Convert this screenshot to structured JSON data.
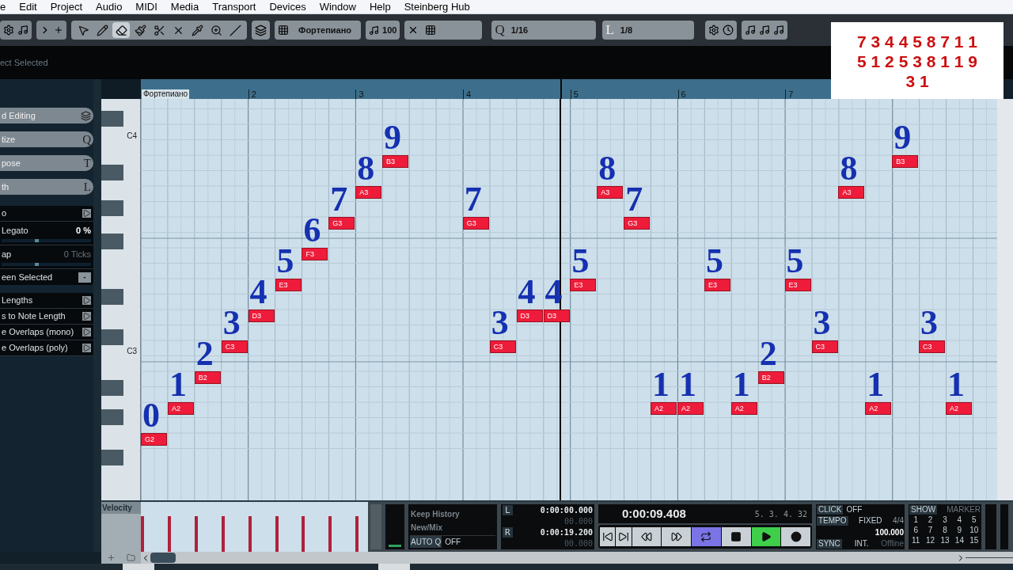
{
  "menu": [
    "e",
    "Edit",
    "Project",
    "Audio",
    "MIDI",
    "Media",
    "Transport",
    "Devices",
    "Window",
    "Help",
    "Steinberg Hub"
  ],
  "toolbar": {
    "tools": [
      {
        "kind": "arrow",
        "selected": false
      },
      {
        "kind": "pencil",
        "selected": false
      },
      {
        "kind": "eraser",
        "selected": true
      },
      {
        "kind": "brush",
        "selected": false
      },
      {
        "kind": "scissors",
        "selected": false
      },
      {
        "kind": "mute",
        "selected": false
      },
      {
        "kind": "glue",
        "selected": false
      },
      {
        "kind": "zoom",
        "selected": false
      },
      {
        "kind": "line",
        "selected": false
      }
    ],
    "instrument": "Фортепиано",
    "velocity": "100",
    "quantize_key": "Q",
    "quantize": "1/16",
    "length_key": "L",
    "length": "1/8"
  },
  "info_line": "ect Selected",
  "overlay_digits": [
    "7 3 4 4 5 8 7 1 1",
    "5 1 2 5 3 8 1 1 9",
    "3 1"
  ],
  "inspector": {
    "sections": [
      {
        "label": "d Editing"
      },
      {
        "label": "tize",
        "key": "Q"
      },
      {
        "label": "pose",
        "key": "T"
      },
      {
        "label": "th",
        "key": "L"
      }
    ],
    "functions": [
      {
        "kind": "run",
        "label": "o"
      },
      {
        "kind": "slider",
        "label": "Legato",
        "value": "0 %",
        "level": 0.37,
        "disabled": false
      },
      {
        "kind": "slider",
        "label": "ap",
        "value": "0 Ticks",
        "level": 0.37,
        "disabled": true
      },
      {
        "kind": "toggle",
        "label": "een Selected",
        "button": "-"
      }
    ],
    "actions": [
      {
        "label": "Lengths"
      },
      {
        "label": "s to Note Length"
      },
      {
        "label": "e Overlaps (mono)"
      },
      {
        "label": "e Overlaps (poly)"
      }
    ]
  },
  "keyboard_labels": [
    "C4",
    "C3"
  ],
  "ruler": {
    "track_label": "Фортепиано",
    "bars": [
      "2",
      "3",
      "4",
      "5",
      "6",
      "7"
    ]
  },
  "notes": [
    {
      "pitch": "G2",
      "number": "0"
    },
    {
      "pitch": "A2",
      "number": "1"
    },
    {
      "pitch": "B2",
      "number": "2"
    },
    {
      "pitch": "C3",
      "number": "3"
    },
    {
      "pitch": "D3",
      "number": "4"
    },
    {
      "pitch": "E3",
      "number": "5"
    },
    {
      "pitch": "F3",
      "number": "6"
    },
    {
      "pitch": "G3",
      "number": "7"
    },
    {
      "pitch": "A3",
      "number": "8"
    },
    {
      "pitch": "B3",
      "number": "9"
    },
    {
      "pitch": "G3",
      "number": "7"
    },
    {
      "pitch": "C3",
      "number": "3"
    },
    {
      "pitch": "D3",
      "number": "4"
    },
    {
      "pitch": "D3",
      "number": "4"
    },
    {
      "pitch": "E3",
      "number": "5"
    },
    {
      "pitch": "A3",
      "number": "8"
    },
    {
      "pitch": "G3",
      "number": "7"
    },
    {
      "pitch": "A2",
      "number": "1"
    },
    {
      "pitch": "A2",
      "number": "1"
    },
    {
      "pitch": "E3",
      "number": "5"
    },
    {
      "pitch": "A2",
      "number": "1"
    },
    {
      "pitch": "B2",
      "number": "2"
    },
    {
      "pitch": "E3",
      "number": "5"
    },
    {
      "pitch": "C3",
      "number": "3"
    },
    {
      "pitch": "A3",
      "number": "8"
    },
    {
      "pitch": "A2",
      "number": "1"
    },
    {
      "pitch": "B3",
      "number": "9"
    },
    {
      "pitch": "C3",
      "number": "3"
    },
    {
      "pitch": "A2",
      "number": "1"
    }
  ],
  "velocity_label": "Velocity",
  "transport": {
    "history": [
      "Keep History",
      "New/Mix"
    ],
    "auto_q": "AUTO Q",
    "auto_q_value": "OFF",
    "left_key": "L",
    "left_time": "0:00:00.000",
    "left_sub": "00.000",
    "right_key": "R",
    "right_time": "0:00:19.200",
    "right_sub": "00.000",
    "time": "0:00:09.408",
    "bars": "5. 3. 4. 32",
    "buttons": [
      {
        "kind": "start",
        "on": false
      },
      {
        "kind": "end",
        "on": false
      },
      {
        "kind": "rewind",
        "on": false
      },
      {
        "kind": "forward",
        "on": false
      },
      {
        "kind": "cycle",
        "on": true
      },
      {
        "kind": "stop",
        "on": false
      },
      {
        "kind": "play",
        "on": true
      },
      {
        "kind": "record",
        "on": false
      }
    ],
    "click": "CLICK",
    "click_value": "OFF",
    "tempo": "TEMPO",
    "tempo_mode": "FIXED",
    "signature": "4/4",
    "tempo_value": "100.000",
    "sync": "SYNC",
    "sync_value": "INT.",
    "sync_state": "Offline",
    "show": "SHOW",
    "marker": "MARKER",
    "markers": [
      "1",
      "2",
      "3",
      "4",
      "5",
      "6",
      "7",
      "8",
      "9",
      "10",
      "11",
      "12",
      "13",
      "14",
      "15"
    ]
  }
}
